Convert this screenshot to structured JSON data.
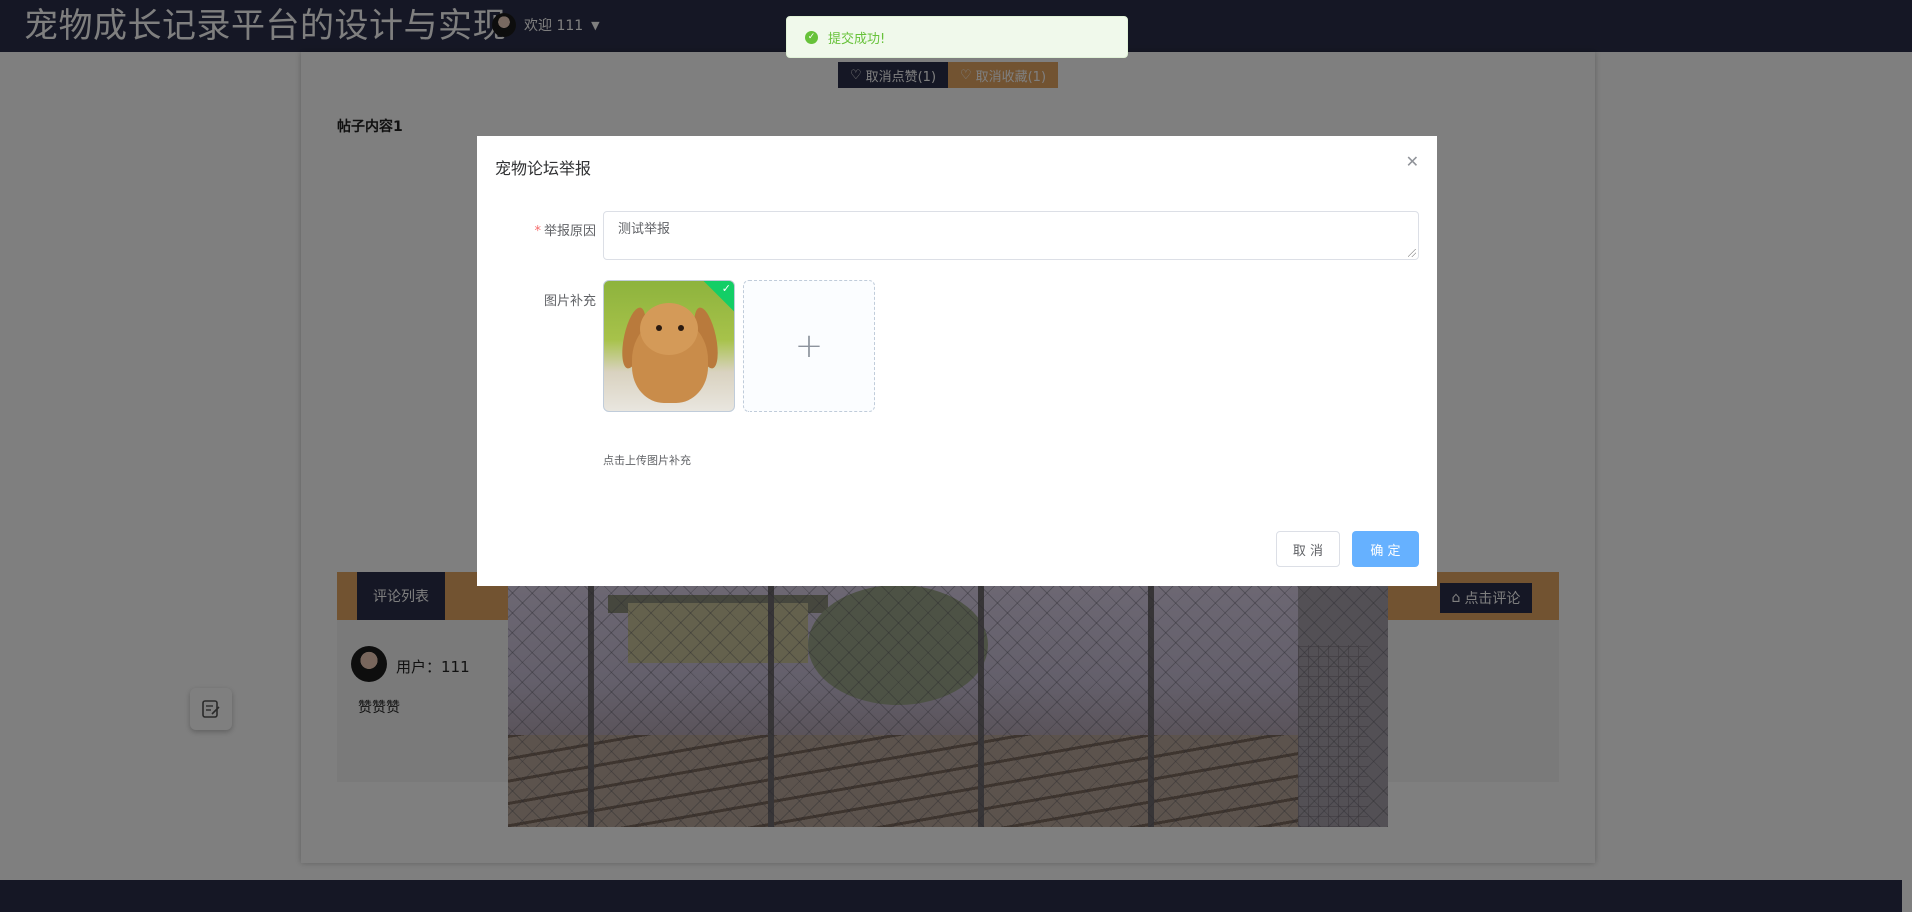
{
  "header": {
    "site_title": "宠物成长记录平台的设计与实现",
    "welcome": "欢迎 111",
    "dropdown_icon": "caret-down-icon"
  },
  "post": {
    "unlike_label": "取消点赞(1)",
    "unfavorite_label": "取消收藏(1)",
    "content": "帖子内容1"
  },
  "comments": {
    "tab_label": "评论列表",
    "add_button": "点击评论",
    "items": [
      {
        "user": "用户：111",
        "text": "赞赞赞"
      }
    ]
  },
  "modal": {
    "title": "宠物论坛举报",
    "reason_label": "举报原因",
    "required_mark": "*",
    "reason_value": "测试举报",
    "image_label": "图片补充",
    "upload_hint": "点击上传图片补充",
    "cancel": "取 消",
    "confirm": "确 定"
  },
  "toast": {
    "message": "提交成功!"
  },
  "colors": {
    "nav_dark": "#2b2f4a",
    "accent_orange": "#e4a663",
    "primary_blue": "#66b1ff",
    "success_green": "#67c23a"
  }
}
